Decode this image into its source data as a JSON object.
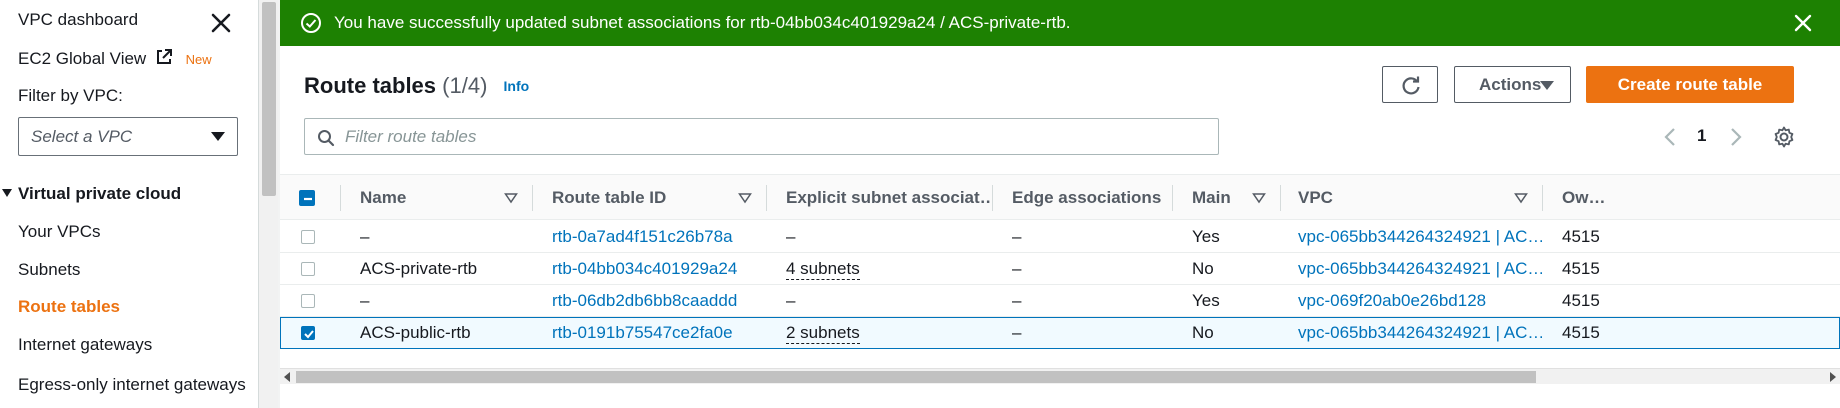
{
  "colors": {
    "accent": "#ec7211",
    "link": "#0073bb",
    "success": "#1d8102"
  },
  "sidebar": {
    "title": "VPC dashboard",
    "global_view": "EC2 Global View",
    "new_badge": "New",
    "filter_label": "Filter by VPC:",
    "filter_placeholder": "Select a VPC",
    "section": "Virtual private cloud",
    "items": [
      {
        "label": "Your VPCs",
        "active": false
      },
      {
        "label": "Subnets",
        "active": false
      },
      {
        "label": "Route tables",
        "active": true
      },
      {
        "label": "Internet gateways",
        "active": false
      },
      {
        "label": "Egress-only internet gateways",
        "active": false
      }
    ]
  },
  "flash": {
    "message": "You have successfully updated subnet associations for rtb-04bb034c401929a24 / ACS-private-rtb.",
    "icon": "check-circle-icon"
  },
  "header": {
    "title": "Route tables",
    "count": "(1/4)",
    "info": "Info",
    "actions_label": "Actions",
    "create_label": "Create route table"
  },
  "search": {
    "placeholder": "Filter route tables"
  },
  "pagination": {
    "current_page": "1"
  },
  "table": {
    "columns": [
      "Name",
      "Route table ID",
      "Explicit subnet associat…",
      "Edge associations",
      "Main",
      "VPC",
      "Ow…"
    ],
    "rows": [
      {
        "name": "–",
        "id": "rtb-0a7ad4f151c26b78a",
        "explicit": "–",
        "edge": "–",
        "main": "Yes",
        "vpc": "vpc-065bb344264324921 | AC…",
        "owner": "4515",
        "selected": false
      },
      {
        "name": "ACS-private-rtb",
        "id": "rtb-04bb034c401929a24",
        "explicit": "4 subnets",
        "edge": "–",
        "main": "No",
        "vpc": "vpc-065bb344264324921 | AC…",
        "owner": "4515",
        "selected": false
      },
      {
        "name": "–",
        "id": "rtb-06db2db6bb8caaddd",
        "explicit": "–",
        "edge": "–",
        "main": "Yes",
        "vpc": "vpc-069f20ab0e26bd128",
        "owner": "4515",
        "selected": false
      },
      {
        "name": "ACS-public-rtb",
        "id": "rtb-0191b75547ce2fa0e",
        "explicit": "2 subnets",
        "edge": "–",
        "main": "No",
        "vpc": "vpc-065bb344264324921 | AC…",
        "owner": "4515",
        "selected": true
      }
    ]
  }
}
